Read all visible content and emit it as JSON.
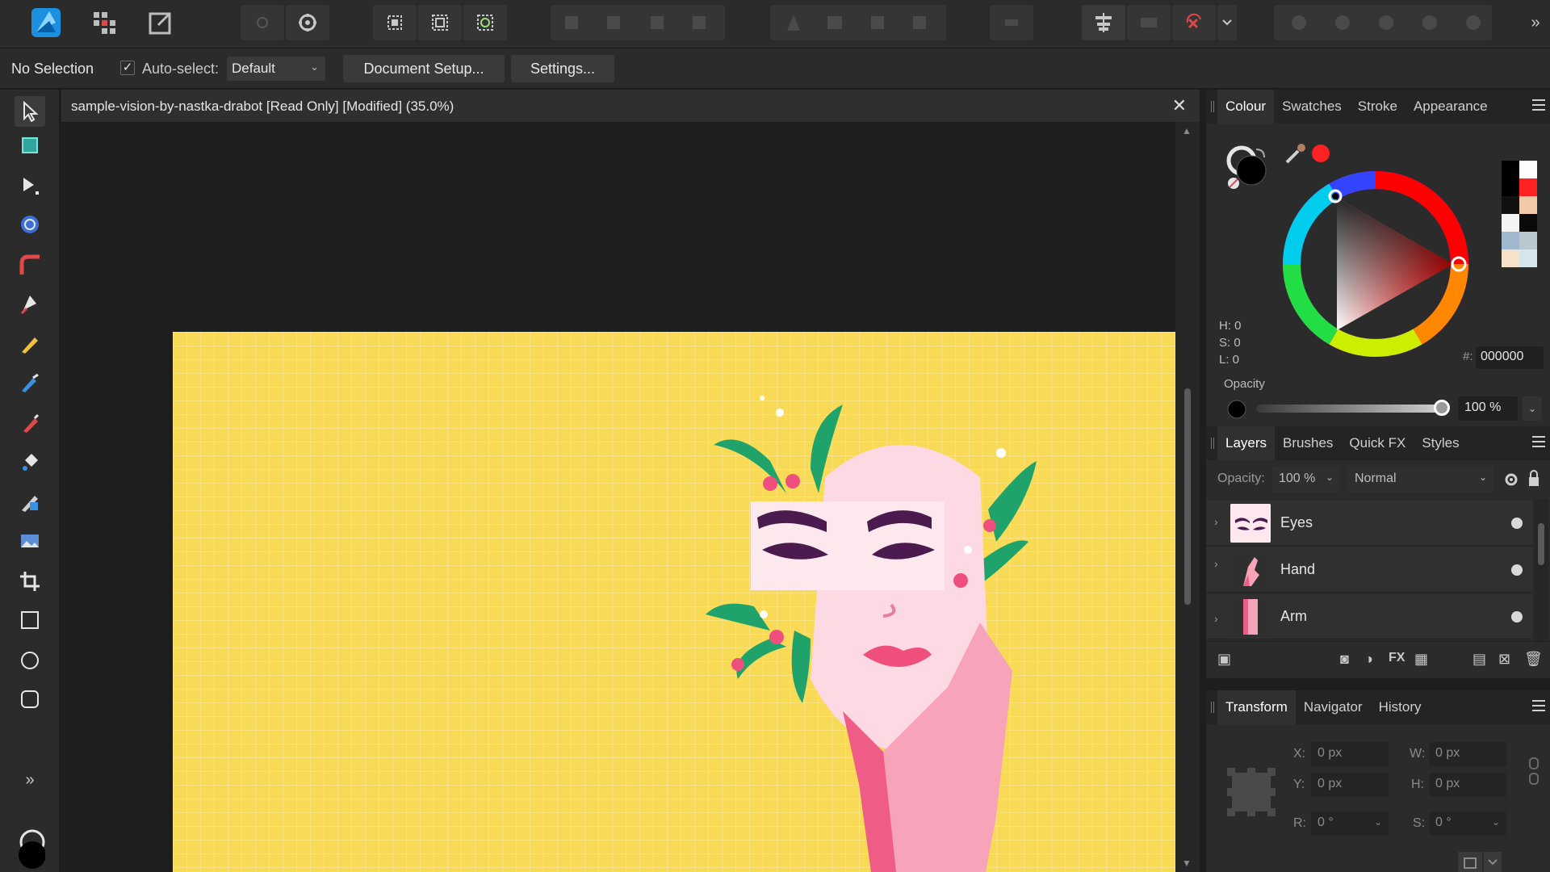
{
  "context": {
    "selection": "No Selection",
    "auto_select_label": "Auto-select:",
    "auto_select_value": "Default",
    "document_setup": "Document Setup...",
    "settings": "Settings..."
  },
  "document": {
    "title": "sample-vision-by-nastka-drabot [Read Only] [Modified] (35.0%)"
  },
  "colour_panel": {
    "tabs": [
      "Colour",
      "Swatches",
      "Stroke",
      "Appearance"
    ],
    "h": "H: 0",
    "s": "S: 0",
    "l": "L: 0",
    "hex_label": "#:",
    "hex": "000000",
    "opacity_label": "Opacity",
    "opacity_value": "100 %",
    "accent_color": "#ff2222"
  },
  "layers_panel": {
    "tabs": [
      "Layers",
      "Brushes",
      "Quick FX",
      "Styles"
    ],
    "opacity_label": "Opacity:",
    "opacity_value": "100 %",
    "blend_mode": "Normal",
    "layers": [
      {
        "name": "Eyes"
      },
      {
        "name": "Hand"
      },
      {
        "name": "Arm"
      }
    ]
  },
  "transform_panel": {
    "tabs": [
      "Transform",
      "Navigator",
      "History"
    ],
    "x_label": "X:",
    "x": "0 px",
    "y_label": "Y:",
    "y": "0 px",
    "w_label": "W:",
    "w": "0 px",
    "h_label": "H:",
    "h": "0 px",
    "r_label": "R:",
    "r": "0 °",
    "s_label": "S:",
    "s": "0 °"
  },
  "icons": {
    "app": "affinity-designer-icon",
    "persona_pixel": "pixel-persona-icon",
    "persona_export": "export-persona-icon"
  }
}
